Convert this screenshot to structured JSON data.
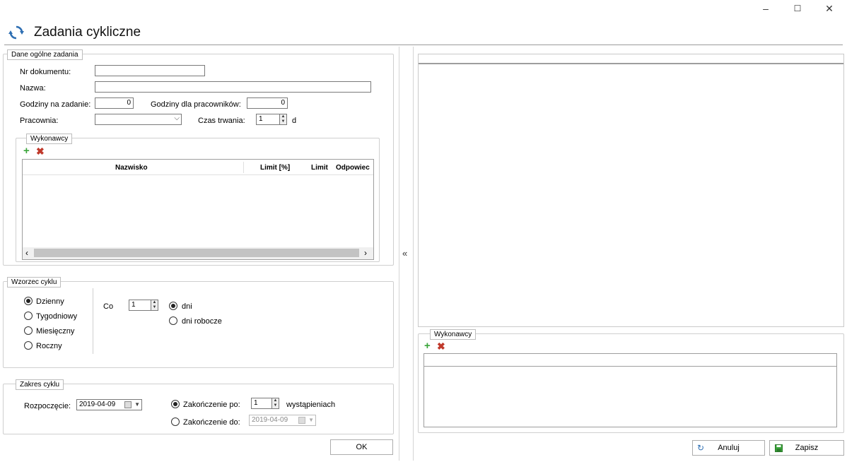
{
  "window": {
    "title": "Zadania cykliczne",
    "min": "–",
    "max": "☐",
    "close": "✕"
  },
  "dane": {
    "legend": "Dane ogólne zadania",
    "nr_label": "Nr dokumentu:",
    "nr_value": "",
    "nazwa_label": "Nazwa:",
    "nazwa_value": "",
    "godz_zad_label": "Godziny na zadanie:",
    "godz_zad_value": "0",
    "godz_prac_label": "Godziny dla pracowników:",
    "godz_prac_value": "0",
    "pracownia_label": "Pracownia:",
    "pracownia_value": "",
    "czas_label": "Czas trwania:",
    "czas_value": "1",
    "czas_unit": "d"
  },
  "wykonawcy": {
    "legend": "Wykonawcy",
    "columns": [
      "Nazwisko",
      "Limit [%]",
      "Limit",
      "Odpowiec"
    ],
    "rows": []
  },
  "wzorzec": {
    "legend": "Wzorzec cyklu",
    "options": [
      "Dzienny",
      "Tygodniowy",
      "Miesięczny",
      "Roczny"
    ],
    "selected": "Dzienny",
    "co_label": "Co",
    "co_value": "1",
    "unit_options": [
      "dni",
      "dni robocze"
    ],
    "unit_selected": "dni"
  },
  "zakres": {
    "legend": "Zakres cyklu",
    "start_label": "Rozpoczęcie:",
    "start_value": "2019-04-09",
    "end_after_label": "Zakończenie po:",
    "end_after_value": "1",
    "end_after_unit": "wystąpieniach",
    "end_by_label": "Zakończenie do:",
    "end_by_value": "2019-04-09",
    "selected": "after"
  },
  "buttons": {
    "ok": "OK",
    "collapse": "«",
    "anuluj": "Anuluj",
    "zapisz": "Zapisz"
  },
  "right": {
    "wykonawcy_legend": "Wykonawcy"
  },
  "colors": {
    "accent": "#2f6fb3",
    "add": "#3aa53a",
    "delete": "#c0392b"
  }
}
